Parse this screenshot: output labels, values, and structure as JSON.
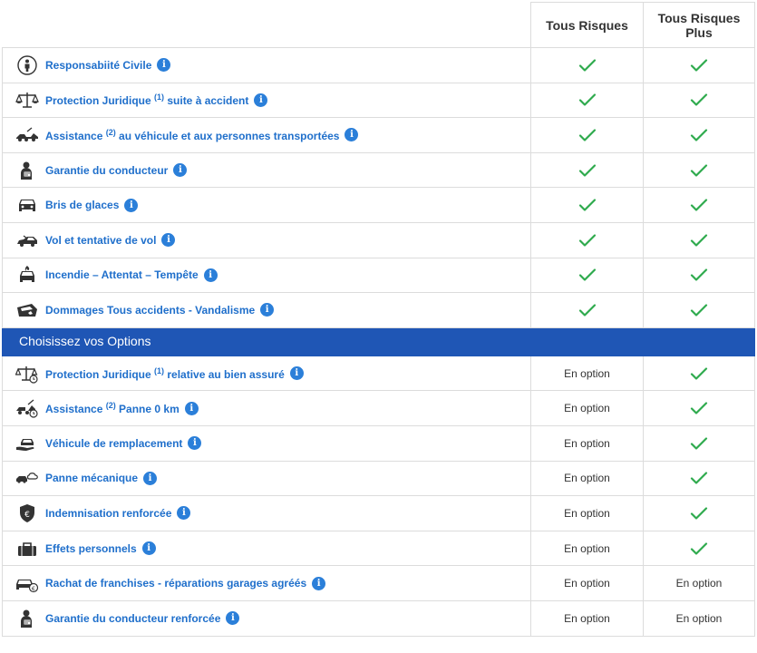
{
  "colors": {
    "link": "#1f6fcb",
    "check": "#2eaa4d",
    "section_bg": "#1f56b5",
    "info_bg": "#2b7fd9"
  },
  "plans": [
    "Tous Risques",
    "Tous Risques Plus"
  ],
  "base_rows": [
    {
      "icon": "person-icon",
      "label": "Responsabiité Civile",
      "sup": "",
      "label_after": "",
      "col1": "check",
      "col2": "check"
    },
    {
      "icon": "scales-icon",
      "label": "Protection Juridique ",
      "sup": "(1)",
      "label_after": " suite à accident",
      "col1": "check",
      "col2": "check"
    },
    {
      "icon": "tow-truck-icon",
      "label": "Assistance ",
      "sup": "(2)",
      "label_after": " au véhicule et aux personnes transportées",
      "col1": "check",
      "col2": "check"
    },
    {
      "icon": "driver-icon",
      "label": "Garantie du conducteur",
      "sup": "",
      "label_after": "",
      "col1": "check",
      "col2": "check"
    },
    {
      "icon": "car-front-icon",
      "label": "Bris de glaces",
      "sup": "",
      "label_after": "",
      "col1": "check",
      "col2": "check"
    },
    {
      "icon": "car-theft-icon",
      "label": "Vol et tentative de vol",
      "sup": "",
      "label_after": "",
      "col1": "check",
      "col2": "check"
    },
    {
      "icon": "car-fire-icon",
      "label": "Incendie – Attentat – Tempête",
      "sup": "",
      "label_after": "",
      "col1": "check",
      "col2": "check"
    },
    {
      "icon": "car-crash-icon",
      "label": "Dommages Tous accidents - Vandalisme",
      "sup": "",
      "label_after": "",
      "col1": "check",
      "col2": "check"
    }
  ],
  "section_title": "Choisissez vos Options",
  "option_rows": [
    {
      "icon": "scales-clock-icon",
      "label": "Protection Juridique ",
      "sup": "(1)",
      "label_after": " relative au bien assuré",
      "col1": "En option",
      "col2": "check"
    },
    {
      "icon": "tow-truck-clock-icon",
      "label": "Assistance ",
      "sup": "(2)",
      "label_after": " Panne 0 km",
      "col1": "En option",
      "col2": "check"
    },
    {
      "icon": "car-hand-icon",
      "label": "Véhicule de remplacement",
      "sup": "",
      "label_after": "",
      "col1": "En option",
      "col2": "check"
    },
    {
      "icon": "car-breakdown-icon",
      "label": "Panne mécanique",
      "sup": "",
      "label_after": "",
      "col1": "En option",
      "col2": "check"
    },
    {
      "icon": "euro-shield-icon",
      "label": "Indemnisation renforcée",
      "sup": "",
      "label_after": "",
      "col1": "En option",
      "col2": "check"
    },
    {
      "icon": "suitcase-icon",
      "label": "Effets personnels",
      "sup": "",
      "label_after": "",
      "col1": "En option",
      "col2": "check"
    },
    {
      "icon": "car-euro-icon",
      "label": "Rachat de franchises - réparations garages agréés",
      "sup": "",
      "label_after": "",
      "col1": "En option",
      "col2": "En option"
    },
    {
      "icon": "driver-icon",
      "label": "Garantie du conducteur renforcée",
      "sup": "",
      "label_after": "",
      "col1": "En option",
      "col2": "En option"
    }
  ]
}
